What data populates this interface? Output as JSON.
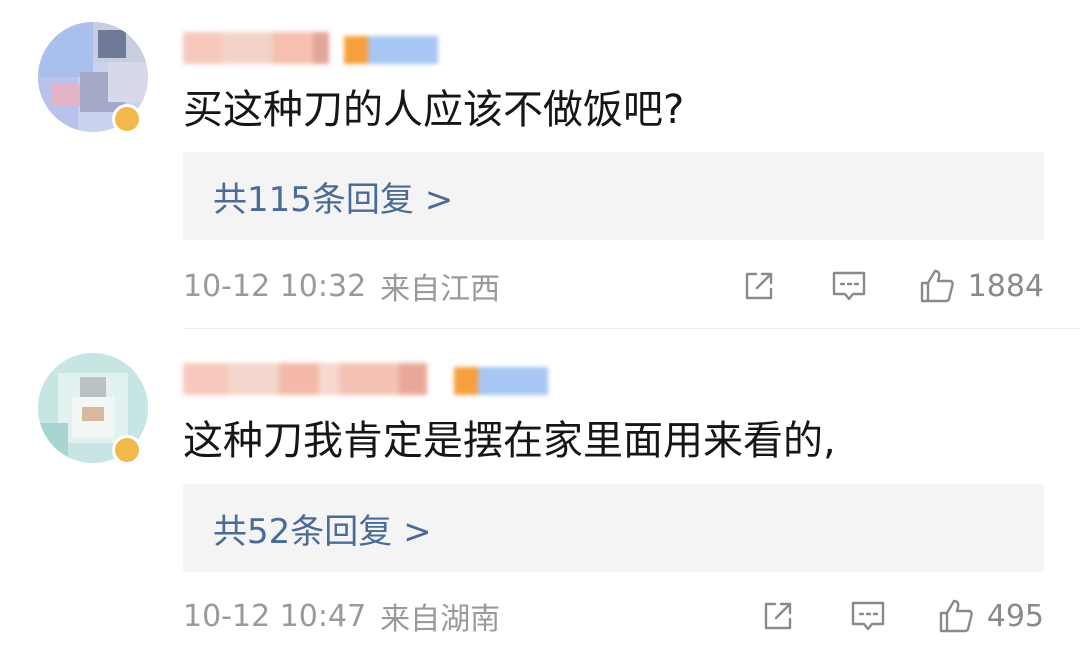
{
  "comments": [
    {
      "text": "买这种刀的人应该不做饭吧?",
      "reply_link": "共115条回复 >",
      "timestamp": "10-12 10:32",
      "location": "来自江西",
      "like_count": "1884",
      "avatar_colors": [
        "#9fb8e8",
        "#c6c9d8",
        "#7f8aa6",
        "#b8c4ee",
        "#e3b7c8",
        "#a7a9c4"
      ],
      "badge_color": "#f2b84b"
    },
    {
      "text": "这种刀我肯定是摆在家里面用来看的,",
      "reply_link": "共52条回复 >",
      "timestamp": "10-12 10:47",
      "location": "来自湖南",
      "like_count": "495",
      "avatar_colors": [
        "#bfe4e2",
        "#d9efec",
        "#a9d7d3",
        "#e6f3f1",
        "#c8b8a8",
        "#d4e9e6"
      ],
      "badge_color": "#f2b84b"
    }
  ],
  "icons": {
    "share": "share-icon",
    "comment": "comment-icon",
    "like": "thumbs-up-icon"
  },
  "colors": {
    "reply_link": "#4a6b96",
    "meta_text": "#9a9a9a",
    "reply_bg": "#f4f4f4"
  }
}
